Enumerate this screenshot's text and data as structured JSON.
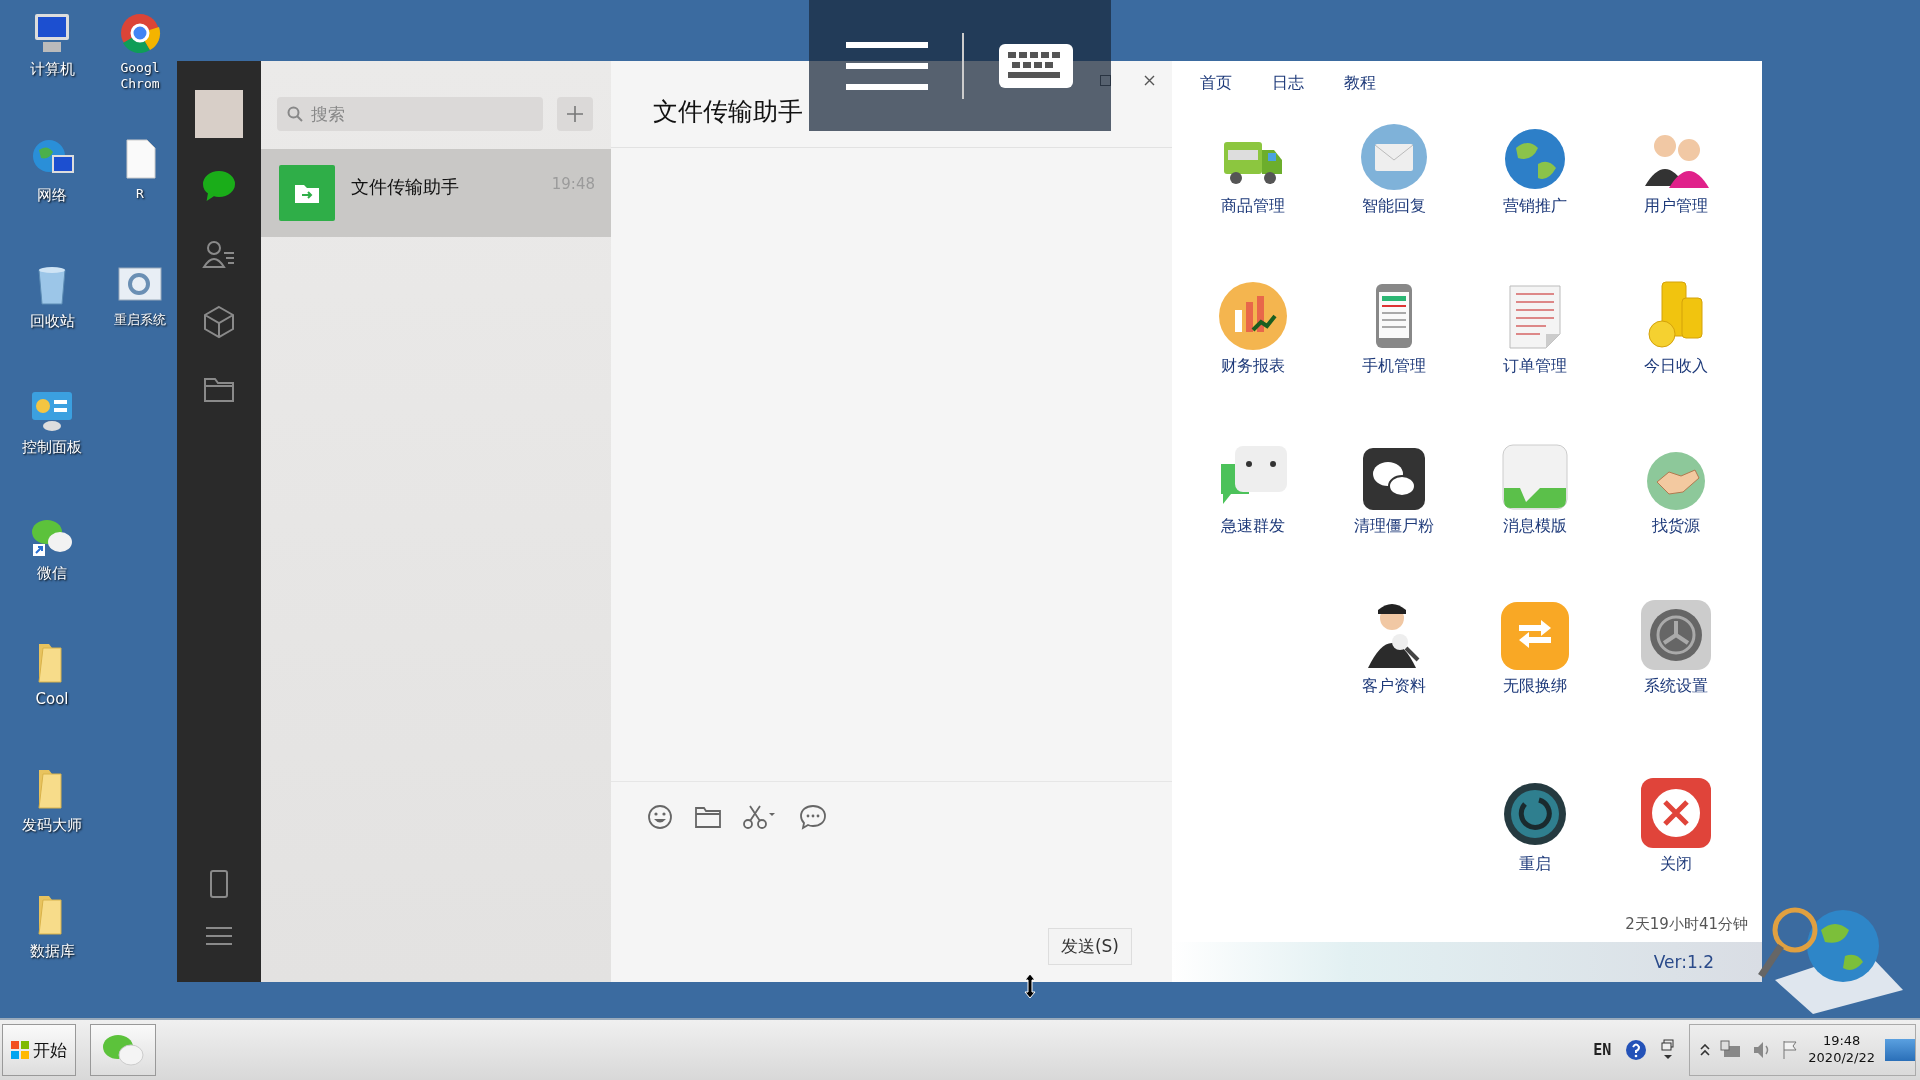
{
  "desktop": {
    "column_1": [
      {
        "label": "计算机"
      },
      {
        "label": "网络"
      },
      {
        "label": "回收站"
      },
      {
        "label": "控制面板"
      },
      {
        "label": "微信"
      },
      {
        "label": "Cool"
      },
      {
        "label": "发码大师"
      },
      {
        "label": "数据库"
      }
    ],
    "column_2": [
      {
        "label": "Googl\nChrom"
      },
      {
        "label": "R"
      },
      {
        "label": "重启系统"
      }
    ]
  },
  "wechat": {
    "sidebar": {
      "items": [
        {
          "kind": "chat",
          "selected": true
        },
        {
          "kind": "contacts",
          "selected": false
        },
        {
          "kind": "favorites",
          "selected": false
        },
        {
          "kind": "files",
          "selected": false
        }
      ],
      "bottom": [
        {
          "kind": "phone"
        },
        {
          "kind": "menu"
        }
      ]
    },
    "search": {
      "placeholder": "搜索"
    },
    "chats": [
      {
        "name": "文件传输助手",
        "time": "19:48",
        "selected": true
      }
    ],
    "chat_title": "文件传输助手",
    "send_button": "发送(S)"
  },
  "tool_panel": {
    "tabs": [
      "首页",
      "日志",
      "教程"
    ],
    "rows": [
      [
        {
          "label": "商品管理"
        },
        {
          "label": "智能回复"
        },
        {
          "label": "营销推广"
        },
        {
          "label": "用户管理"
        }
      ],
      [
        {
          "label": "财务报表"
        },
        {
          "label": "手机管理"
        },
        {
          "label": "订单管理"
        },
        {
          "label": "今日收入"
        }
      ],
      [
        {
          "label": "急速群发"
        },
        {
          "label": "清理僵尸粉"
        },
        {
          "label": "消息模版"
        },
        {
          "label": "找货源"
        }
      ],
      [
        "",
        {
          "label": "客户资料"
        },
        {
          "label": "无限换绑"
        },
        {
          "label": "系统设置"
        }
      ],
      [
        "",
        "",
        {
          "label": "重启"
        },
        {
          "label": "关闭"
        }
      ]
    ],
    "uptime": "2天19小时41分钟",
    "version": "Ver:1.2"
  },
  "taskbar": {
    "start": "开始",
    "language": "EN",
    "clock_time": "19:48",
    "clock_date": "2020/2/22"
  }
}
